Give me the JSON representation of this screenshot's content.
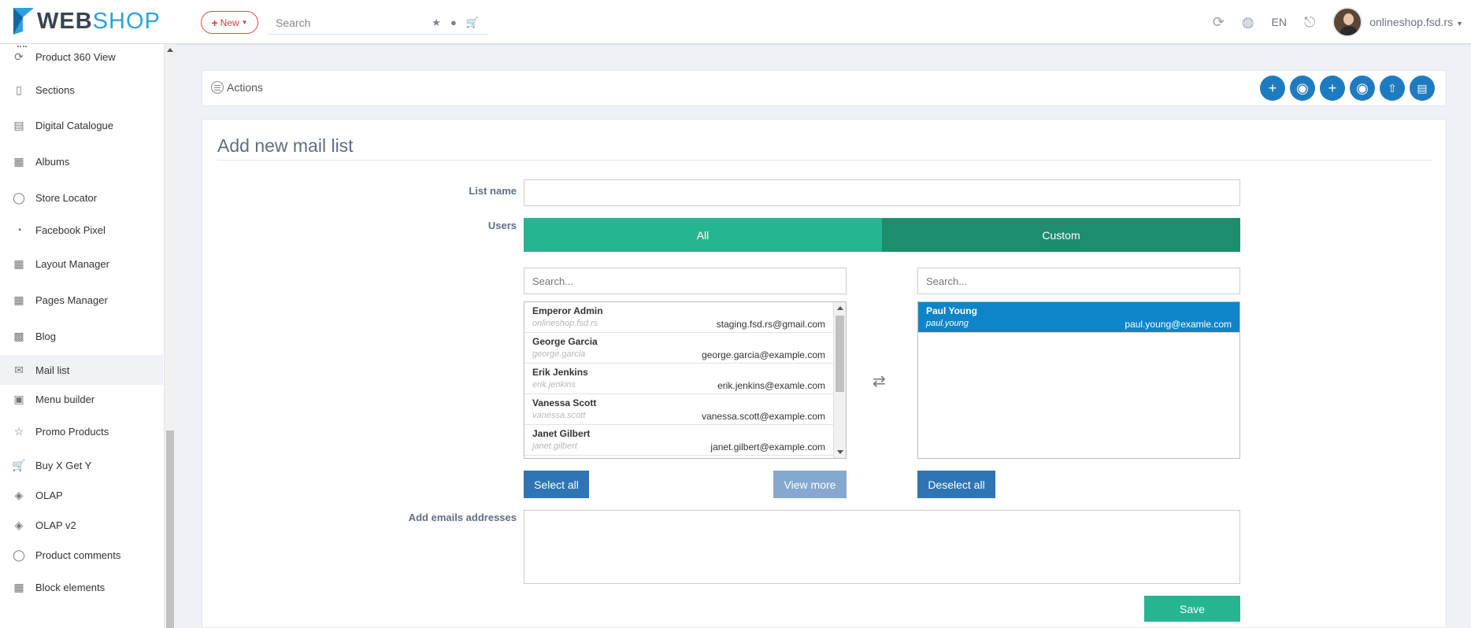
{
  "header": {
    "logo_web": "WEB",
    "logo_shop": "SHOP",
    "new_label": "New",
    "search_placeholder": "Search",
    "language": "EN",
    "account": "onlineshop.fsd.rs"
  },
  "sidebar": {
    "items": [
      {
        "label": "Product 360 View",
        "icon": "rotate-icon"
      },
      {
        "label": "Sections",
        "icon": "phone-icon"
      },
      {
        "label": "Digital Catalogue",
        "icon": "catalogue-icon"
      },
      {
        "label": "Albums",
        "icon": "image-icon"
      },
      {
        "label": "Store Locator",
        "icon": "location-icon"
      },
      {
        "label": "Facebook Pixel",
        "icon": "pie-chart-icon"
      },
      {
        "label": "Layout Manager",
        "icon": "layout-icon"
      },
      {
        "label": "Pages Manager",
        "icon": "layout-icon"
      },
      {
        "label": "Blog",
        "icon": "blog-icon"
      },
      {
        "label": "Mail list",
        "icon": "envelope-icon"
      },
      {
        "label": "Menu builder",
        "icon": "menu-builder-icon"
      },
      {
        "label": "Promo Products",
        "icon": "star-icon"
      },
      {
        "label": "Buy X Get Y",
        "icon": "cart-icon"
      },
      {
        "label": "OLAP",
        "icon": "layers-icon"
      },
      {
        "label": "OLAP v2",
        "icon": "layers-icon"
      },
      {
        "label": "Product comments",
        "icon": "comment-icon"
      },
      {
        "label": "Block elements",
        "icon": "layout-icon"
      }
    ]
  },
  "actions": {
    "label": "Actions"
  },
  "form": {
    "title": "Add new mail list",
    "list_name_label": "List name",
    "list_name_value": "",
    "users_label": "Users",
    "seg_all": "All",
    "seg_custom": "Custom",
    "search_placeholder": "Search...",
    "available_users": [
      {
        "name": "Emperor Admin",
        "username": "onlineshop.fsd.rs",
        "email": "staging.fsd.rs@gmail.com"
      },
      {
        "name": "George Garcia",
        "username": "george.garcia",
        "email": "george.garcia@example.com"
      },
      {
        "name": "Erik Jenkins",
        "username": "erik.jenkins",
        "email": "erik.jenkins@examle.com"
      },
      {
        "name": "Vanessa Scott",
        "username": "vanessa.scott",
        "email": "vanessa.scott@example.com"
      },
      {
        "name": "Janet Gilbert",
        "username": "janet.gilbert",
        "email": "janet.gilbert@example.com"
      }
    ],
    "selected_users": [
      {
        "name": "Paul Young",
        "username": "paul.young",
        "email": "paul.young@examle.com"
      }
    ],
    "select_all": "Select all",
    "view_more": "View more",
    "deselect_all": "Deselect all",
    "emails_label": "Add emails addresses",
    "emails_value": "",
    "save": "Save"
  },
  "colors": {
    "accent_green": "#26b591",
    "dark_green": "#1e8d6e",
    "action_blue": "#1f7bc1",
    "selected_row": "#0e85c9"
  }
}
